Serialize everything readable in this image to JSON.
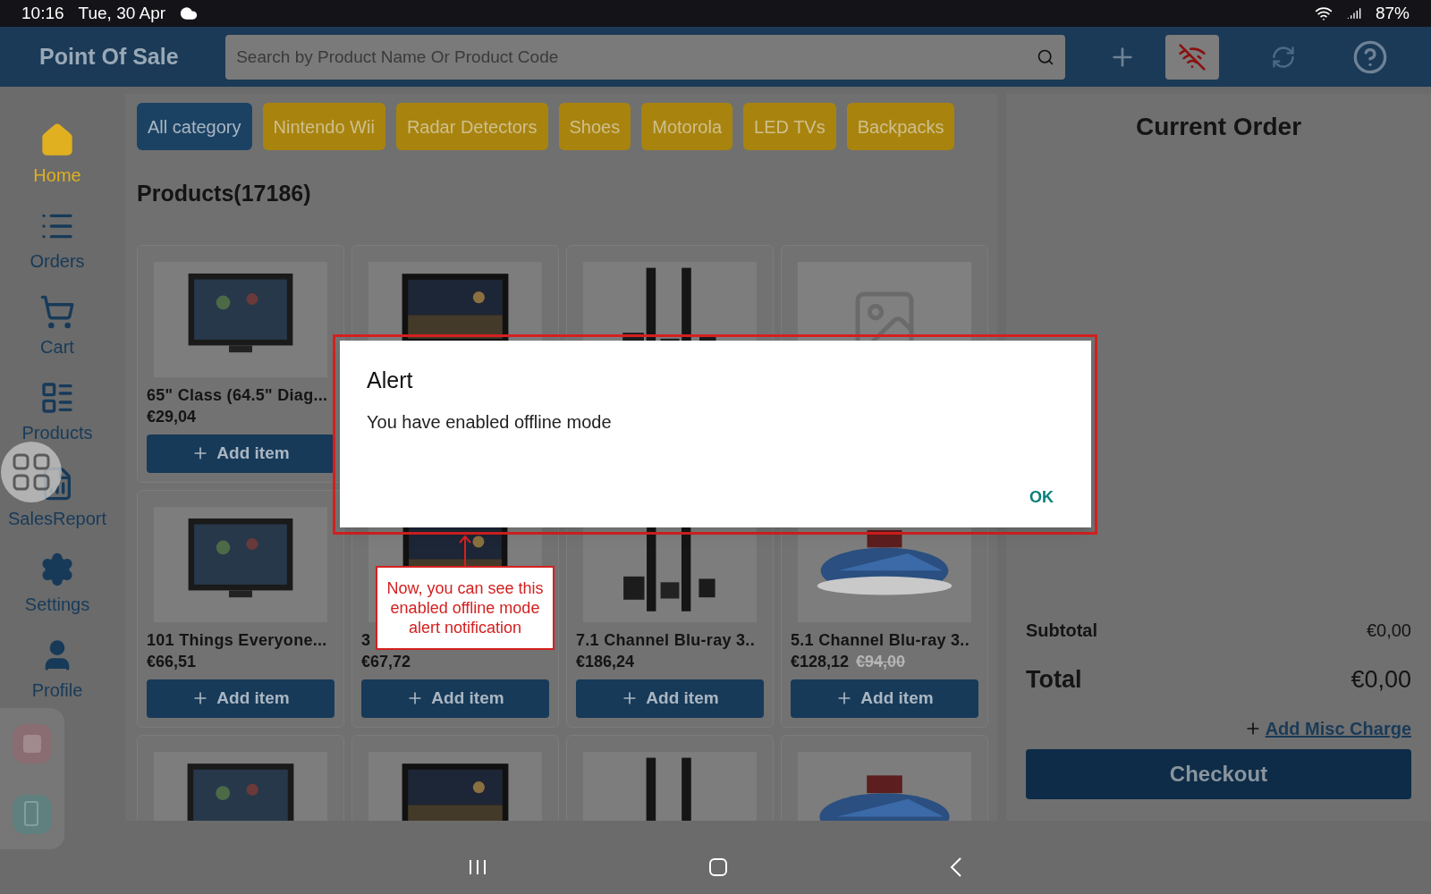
{
  "status_bar": {
    "time": "10:16",
    "date": "Tue, 30 Apr",
    "battery": "87%"
  },
  "header": {
    "title": "Point Of Sale",
    "search": {
      "placeholder": "Search by Product Name Or Product Code"
    },
    "offline_mode": true
  },
  "sidebar": {
    "items": [
      {
        "label": "Home",
        "selected": true
      },
      {
        "label": "Orders",
        "selected": false
      },
      {
        "label": "Cart",
        "selected": false
      },
      {
        "label": "Products",
        "selected": false
      },
      {
        "label": "SalesReport",
        "selected": false
      },
      {
        "label": "Settings",
        "selected": false
      },
      {
        "label": "Profile",
        "selected": false
      }
    ]
  },
  "categories": [
    {
      "label": "All category",
      "selected": true
    },
    {
      "label": "Nintendo Wii",
      "selected": false
    },
    {
      "label": "Radar Detectors",
      "selected": false
    },
    {
      "label": "Shoes",
      "selected": false
    },
    {
      "label": "Motorola",
      "selected": false
    },
    {
      "label": "LED TVs",
      "selected": false
    },
    {
      "label": "Backpacks",
      "selected": false
    }
  ],
  "products_heading": "Products(17186)",
  "products": [
    {
      "kind": "picture",
      "title": "65\" Class (64.5\" Diag...",
      "price": "€29,04",
      "button": "Add item"
    },
    {
      "kind": "picture"
    },
    {
      "kind": "picture"
    },
    {
      "kind": "placeholder"
    },
    {
      "kind": "picture",
      "title": "101 Things Everyone...",
      "price": "€66,51",
      "button": "Add item"
    },
    {
      "kind": "picture",
      "title": "3",
      "price": "€67,72",
      "button": "Add item"
    },
    {
      "kind": "picture",
      "title": "7.1 Channel Blu-ray 3..",
      "price": "€186,24",
      "button": "Add item"
    },
    {
      "kind": "picture",
      "title": "5.1 Channel Blu-ray 3..",
      "price": "€128,12",
      "old_price": "€94,00",
      "button": "Add item"
    },
    {
      "kind": "picture"
    },
    {
      "kind": "picture"
    },
    {
      "kind": "picture"
    },
    {
      "kind": "picture"
    }
  ],
  "order": {
    "title": "Current Order",
    "subtotal_label": "Subtotal",
    "subtotal": "€0,00",
    "total_label": "Total",
    "total": "€0,00",
    "misc_link": "Add Misc Charge",
    "checkout": "Checkout"
  },
  "dialog": {
    "title": "Alert",
    "message": "You have enabled offline mode",
    "button": "OK"
  },
  "callout": {
    "text": "Now, you can see this enabled offline mode alert notification"
  }
}
